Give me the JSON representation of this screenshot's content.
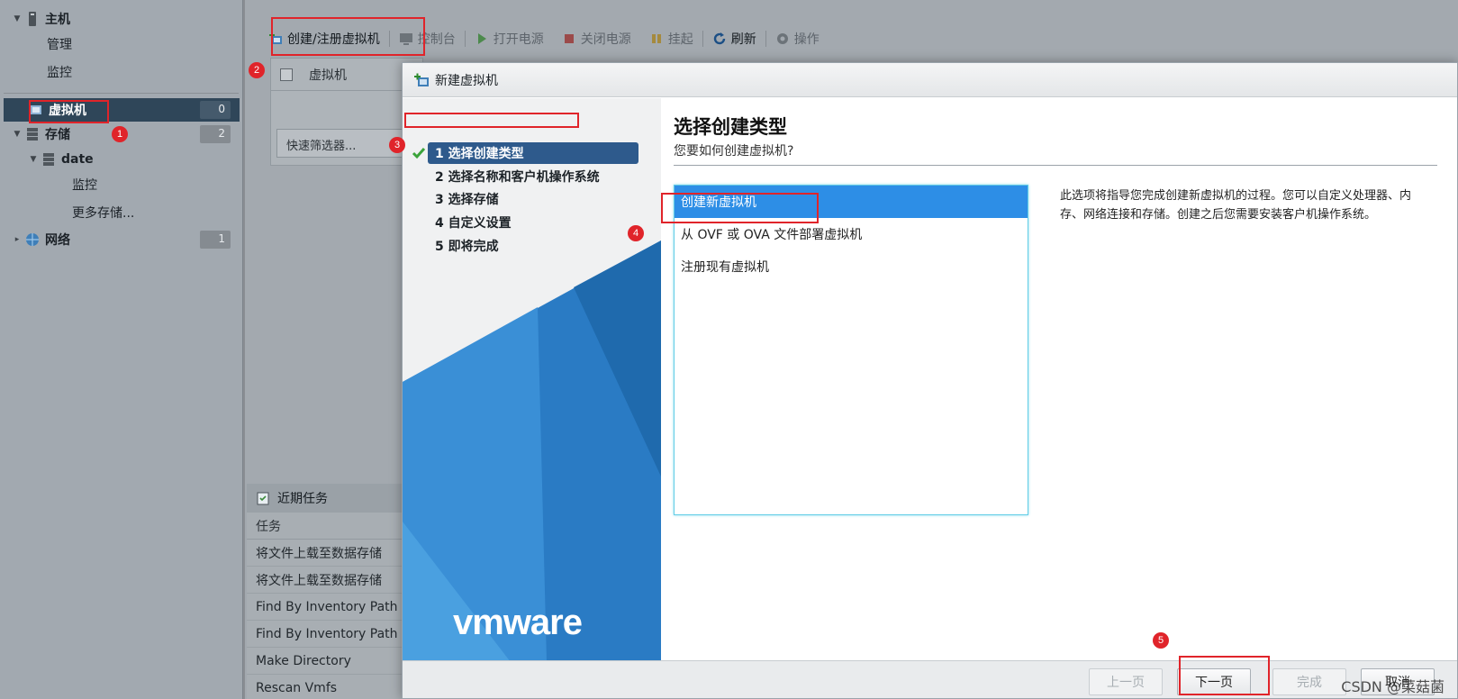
{
  "sidebar": {
    "host": "主机",
    "manage": "管理",
    "monitor": "监控",
    "vms": "虚拟机",
    "vms_count": "0",
    "storage": "存储",
    "storage_count": "2",
    "datastore": "date",
    "ds_monitor": "监控",
    "more_storage": "更多存储...",
    "network": "网络",
    "network_count": "1"
  },
  "toolbar": {
    "create": "创建/注册虚拟机",
    "console": "控制台",
    "power_on": "打开电源",
    "power_off": "关闭电源",
    "suspend": "挂起",
    "refresh": "刷新",
    "actions": "操作"
  },
  "grid": {
    "col_vm": "虚拟机",
    "filter_placeholder": "快速筛选器..."
  },
  "tasks": {
    "title": "近期任务",
    "col_task": "任务",
    "rows": [
      "将文件上载至数据存储",
      "将文件上载至数据存储",
      "Find By Inventory Path",
      "Find By Inventory Path",
      "Make Directory",
      "Rescan Vmfs"
    ]
  },
  "annotations": [
    "1",
    "2",
    "3",
    "4",
    "5"
  ],
  "dialog": {
    "title": "新建虚拟机",
    "steps": [
      "1 选择创建类型",
      "2 选择名称和客户机操作系统",
      "3 选择存储",
      "4 自定义设置",
      "5 即将完成"
    ],
    "brand": "vmware",
    "heading": "选择创建类型",
    "question": "您要如何创建虚拟机?",
    "options": [
      "创建新虚拟机",
      "从 OVF 或 OVA 文件部署虚拟机",
      "注册现有虚拟机"
    ],
    "selected_option": 0,
    "description": "此选项将指导您完成创建新虚拟机的过程。您可以自定义处理器、内存、网络连接和存储。创建之后您需要安装客户机操作系统。",
    "buttons": {
      "prev": "上一页",
      "next": "下一页",
      "finish": "完成",
      "cancel": "取消"
    },
    "watermark": "CSDN @菜菇菌"
  },
  "colors": {
    "accent": "#2d8ee6",
    "active_step": "#2e5a8c",
    "annotation": "#e0242a",
    "vmware_blue": "#2a7bc4"
  }
}
